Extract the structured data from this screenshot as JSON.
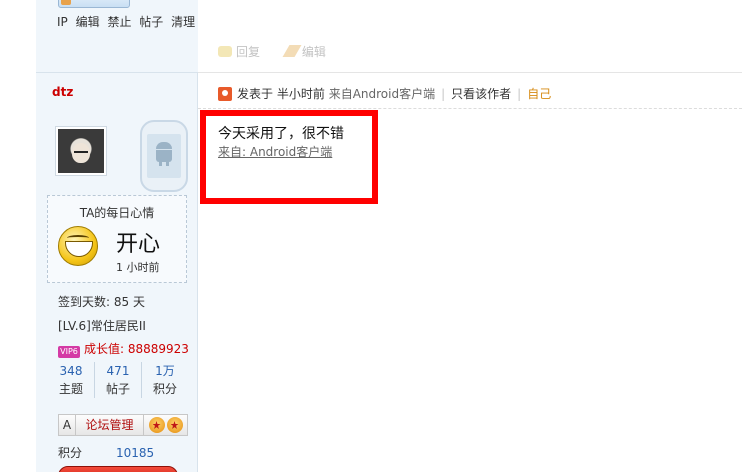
{
  "admin_links": [
    "IP",
    "编辑",
    "禁止",
    "帖子",
    "清理"
  ],
  "reply_bar": {
    "reply": "回复",
    "edit": "编辑"
  },
  "user": {
    "name": "dtz",
    "mood_title": "TA的每日心情",
    "mood": "开心",
    "mood_time": "1 小时前",
    "sign_days": "签到天数: 85 天",
    "level": "[LV.6]常住居民II",
    "vip_badge": "VIP6",
    "growth": "成长值: 88889923",
    "stats": [
      {
        "num": "348",
        "label": "主题"
      },
      {
        "num": "471",
        "label": "帖子"
      },
      {
        "num": "1万",
        "label": "积分"
      }
    ],
    "medal_a": "A",
    "medal_admin": "论坛管理",
    "score_label": "积分",
    "score_value": "10185"
  },
  "post": {
    "posted_label": "发表于",
    "time": "半小时前",
    "source": "来自Android客户端",
    "only_author": "只看该作者",
    "self": "自己",
    "content": "今天采用了，很不错",
    "from": "来自: Android客户端"
  },
  "colors": {
    "highlight": "#ff0000",
    "sidebar_bg": "#f0f6fb",
    "accent_link": "#2a62b0"
  }
}
